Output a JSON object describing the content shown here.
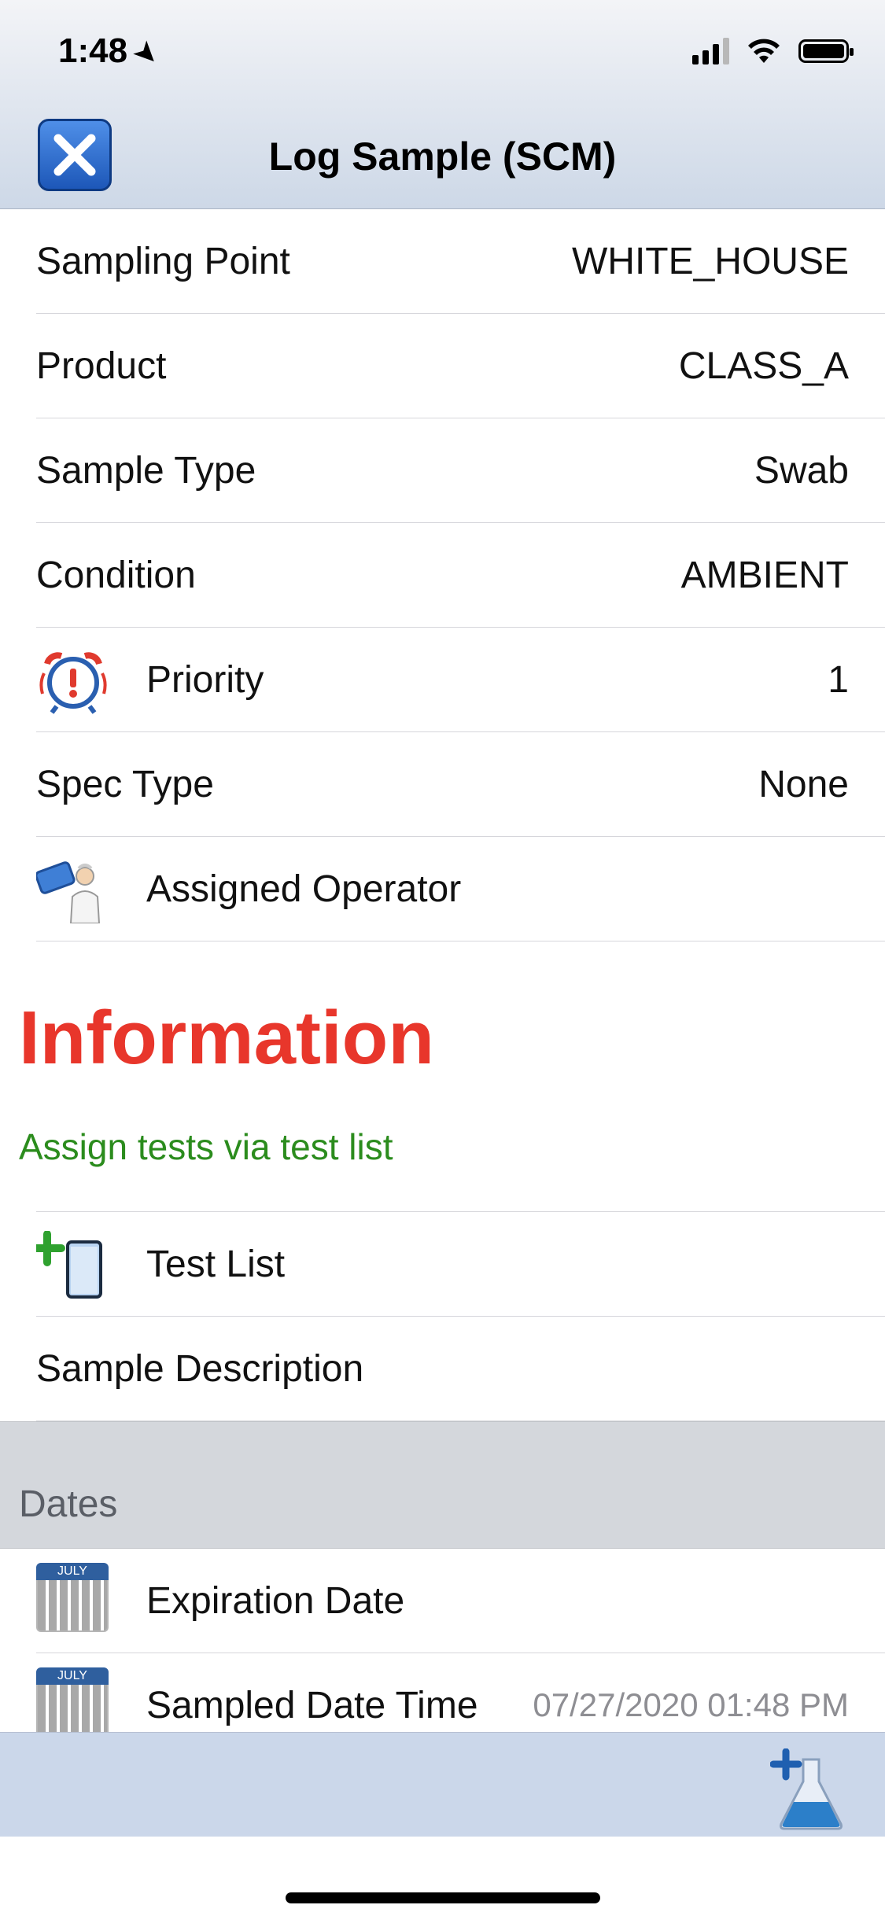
{
  "status_bar": {
    "time": "1:48"
  },
  "nav": {
    "title": "Log Sample (SCM)"
  },
  "fields": [
    {
      "label": "Sampling Point",
      "value": "WHITE_HOUSE"
    },
    {
      "label": "Product",
      "value": "CLASS_A"
    },
    {
      "label": "Sample Type",
      "value": "Swab"
    },
    {
      "label": "Condition",
      "value": "AMBIENT"
    },
    {
      "label": "Priority",
      "value": "1",
      "icon": "alarm-clock-icon"
    },
    {
      "label": "Spec Type",
      "value": "None"
    },
    {
      "label": "Assigned Operator",
      "value": "",
      "icon": "operator-icon"
    }
  ],
  "information": {
    "title": "Information",
    "message": "Assign tests via test list"
  },
  "test_list": {
    "label": "Test List",
    "icon": "test-tube-add-icon"
  },
  "sample_description": {
    "label": "Sample Description"
  },
  "dates_section": {
    "header": "Dates",
    "calendar_month": "JULY",
    "items": [
      {
        "label": "Expiration Date",
        "value": "",
        "icon": "calendar-icon"
      },
      {
        "label": "Sampled Date Time",
        "value": "07/27/2020 01:48 PM",
        "icon": "calendar-icon"
      }
    ]
  },
  "colors": {
    "accent_red": "#e8362b",
    "info_green": "#2b8c1d",
    "bar_blue": "#cbd7ea"
  }
}
